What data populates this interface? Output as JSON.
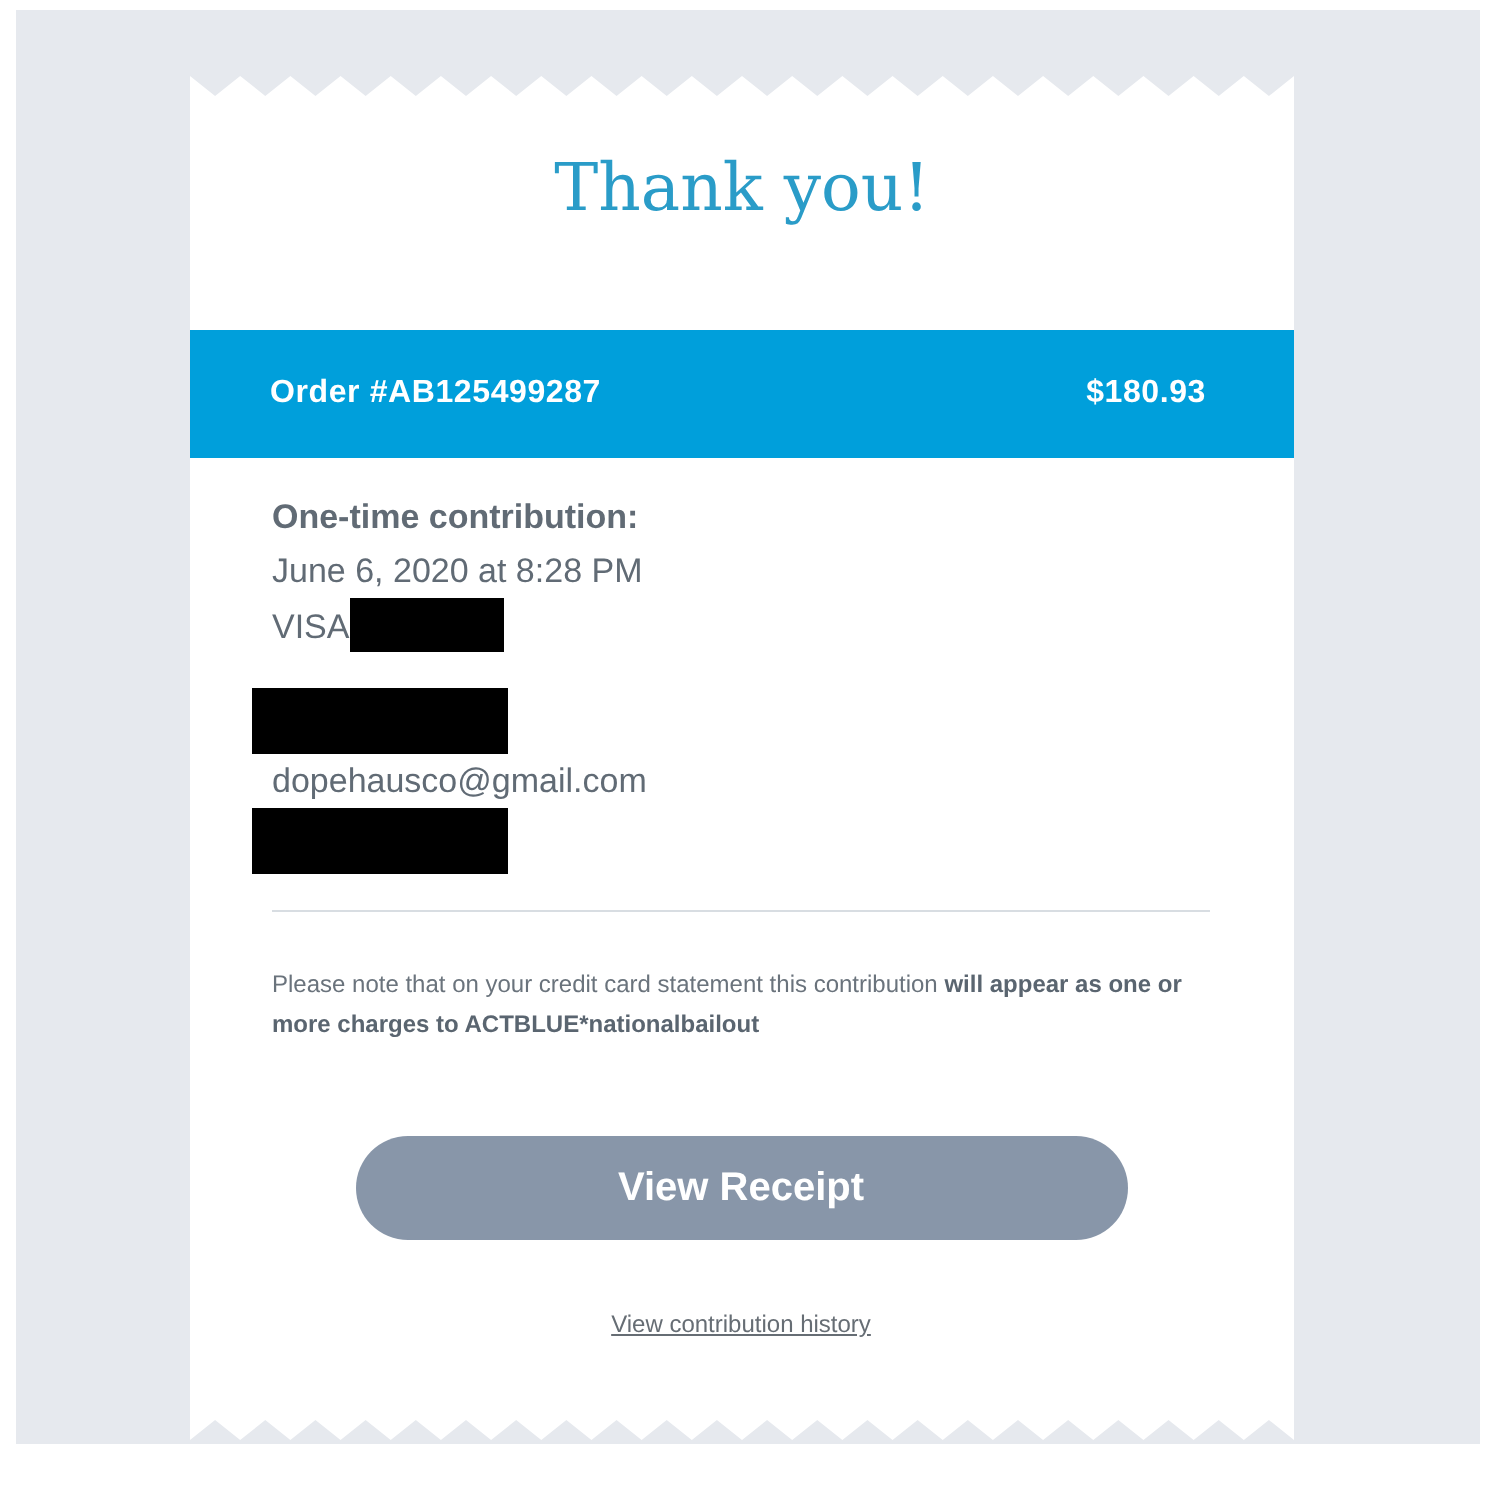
{
  "title": "Thank you!",
  "order": {
    "label": "Order #AB125499287",
    "amount": "$180.93"
  },
  "contribution": {
    "heading": "One-time contribution:",
    "lines": [
      {
        "kind": "text",
        "text": "June 6, 2020 at 8:28 PM"
      },
      {
        "kind": "text-redacted",
        "text": "VISA"
      },
      {
        "kind": "gap"
      },
      {
        "kind": "redacted"
      },
      {
        "kind": "text",
        "text": "dopehausco@gmail.com"
      },
      {
        "kind": "redacted"
      }
    ]
  },
  "note": "Please note that on your credit card statement this contribution **will appear as one or more charges to ACTBLUE*nationalbailout**",
  "button": {
    "label": "View Receipt"
  },
  "link": {
    "label": "View contribution history"
  }
}
